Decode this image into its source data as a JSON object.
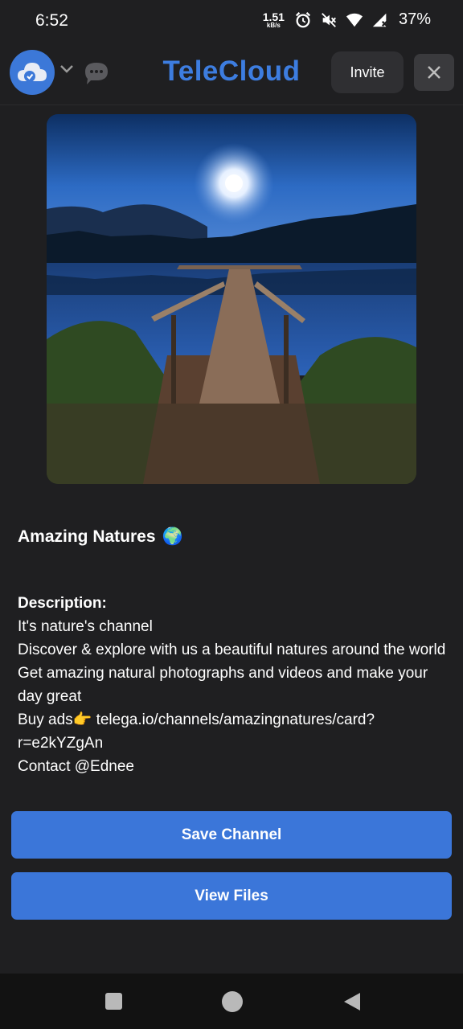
{
  "status_bar": {
    "time": "6:52",
    "net_speed": "1.51",
    "net_unit": "kB/s",
    "battery": "37%"
  },
  "header": {
    "brand": "TeleCloud",
    "invite_label": "Invite",
    "icons": [
      "cloud-avatar-icon",
      "chevron-down-icon",
      "chat-bubble-icon",
      "close-icon"
    ]
  },
  "channel": {
    "title": "Amazing Natures",
    "title_emoji": "🌍",
    "description_heading": "Description:",
    "description_lines": [
      "It's nature's channel",
      "Discover & explore with us a beautiful natures around the world",
      "Get amazing natural photographs and videos and make your day great",
      "Buy ads👉 telega.io/channels/amazingnatures/card?r=e2kYZgAn",
      "Contact @Ednee"
    ]
  },
  "actions": {
    "save_label": "Save Channel",
    "view_files_label": "View Files"
  },
  "colors": {
    "background": "#1f1f21",
    "accent": "#3b76d9",
    "brand": "#3d7de0"
  }
}
